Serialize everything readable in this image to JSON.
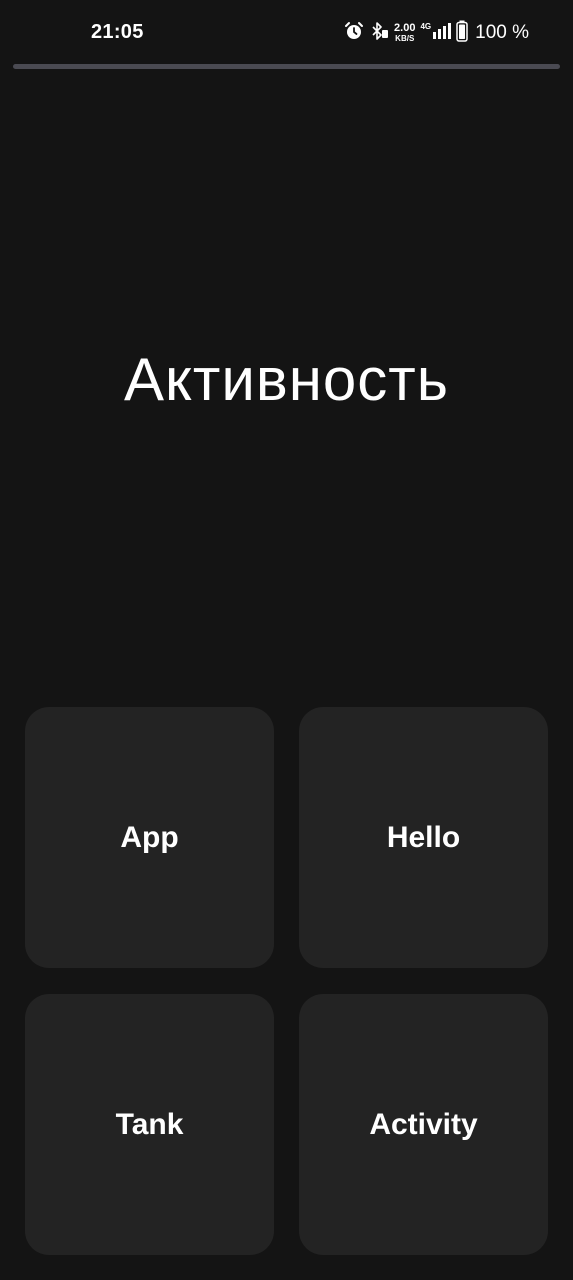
{
  "status_bar": {
    "time": "21:05",
    "net_speed_value": "2.00",
    "net_speed_unit": "KB/S",
    "network_type": "4G",
    "battery": "100 %",
    "icons": [
      "alarm-icon",
      "bluetooth-icon",
      "signal-icon",
      "battery-icon"
    ]
  },
  "main": {
    "title": "Активность",
    "tiles": [
      {
        "label": "App"
      },
      {
        "label": "Hello"
      },
      {
        "label": "Tank"
      },
      {
        "label": "Activity"
      }
    ]
  },
  "colors": {
    "background": "#141414",
    "tile": "#232323",
    "progress_track": "#4a4a52",
    "text": "#ffffff"
  }
}
